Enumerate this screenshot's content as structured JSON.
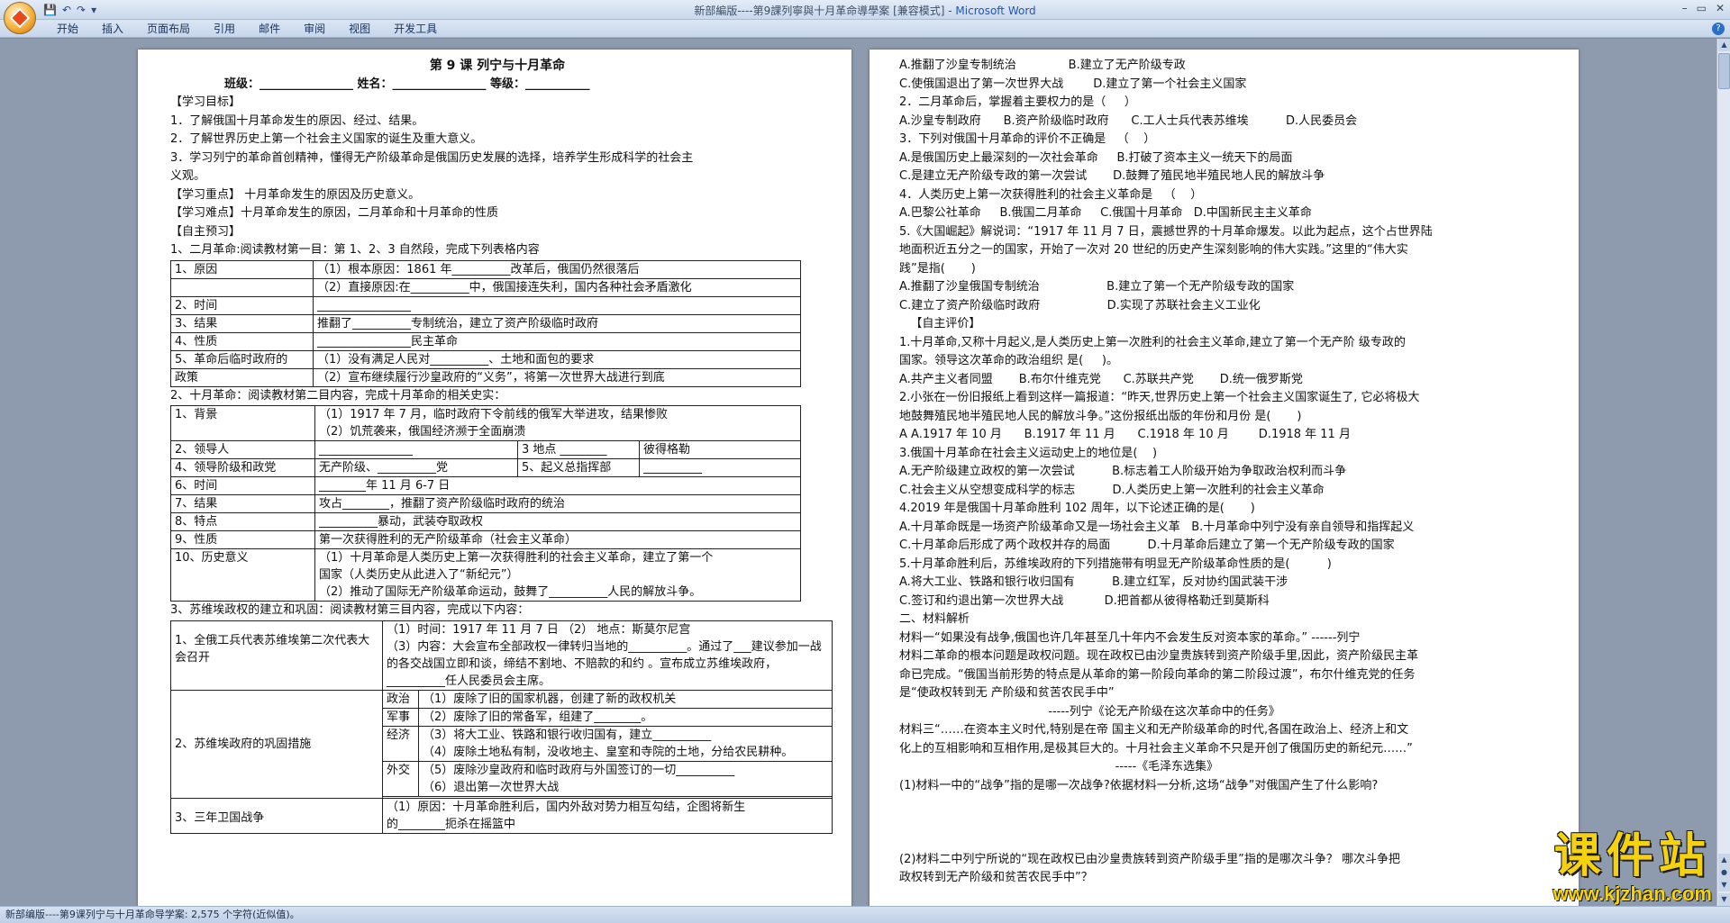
{
  "window": {
    "title_doc": "新部編版----第9課列寧與十月革命導學案 [兼容模式] - ",
    "title_app": "Microsoft Word",
    "qat": [
      "💾",
      "↶",
      "↷",
      "▾"
    ],
    "controls": [
      "–",
      "▭",
      "✕"
    ]
  },
  "ribbon": {
    "tabs": [
      "开始",
      "插入",
      "页面布局",
      "引用",
      "邮件",
      "审阅",
      "视图",
      "开发工具"
    ]
  },
  "page1": {
    "title": "第 9 课 列宁与十月革命",
    "header_line": "班级：________________  姓名：________________  等级：___________",
    "goals_head": "【学习目标】",
    "goals": [
      "1．了解俄国十月革命发生的原因、经过、结果。",
      "2．了解世界历史上第一个社会主义国家的诞生及重大意义。",
      "3．学习列宁的革命首创精神，懂得无产阶级革命是俄国历史发展的选择，培养学生形成科学的社会主",
      "义观。"
    ],
    "key": "【学习重点】  十月革命发生的原因及历史意义。",
    "difficult": "【学习难点】十月革命发生的原因，二月革命和十月革命的性质",
    "preview_head": "【自主预习】",
    "s1_title": "1、二月革命:阅读教材第一目：第 1、2、3 自然段，完成下列表格内容",
    "t1": [
      [
        "1、原因",
        "（1）根本原因：1861 年__________改革后，俄国仍然很落后"
      ],
      [
        "",
        "（2）直接原因:在__________中，俄国接连失利，国内各种社会矛盾激化"
      ],
      [
        "2、时间",
        "________________"
      ],
      [
        "3、结果",
        "推翻了__________专制统治，建立了资产阶级临时政府"
      ],
      [
        "4、性质",
        "________________民主革命"
      ],
      [
        "5、革命后临时政府的",
        "（1）没有满足人民对__________、土地和面包的要求"
      ],
      [
        "政策",
        "（2）宣布继续履行沙皇政府的“义务”，将第一次世界大战进行到底"
      ]
    ],
    "s2_title": "2、十月革命：阅读教材第二目内容，完成十月革命的相关史实：",
    "t2": {
      "bg_label": "1、背景",
      "bg_1": "（1）1917 年 7 月，临时政府下令前线的俄军大举进攻，结果惨败",
      "bg_2": "（2）饥荒袭来，俄国经济濒于全面崩溃",
      "leader_label": "2、领导人",
      "leader_val": "________________",
      "place_label": "3 地点",
      "place_val": "________",
      "place_name": "彼得格勒",
      "class_label": "4、领导阶级和政党",
      "class_val": "无产阶级、__________党",
      "hq_label": "5、起义总指挥部",
      "hq_val": "__________",
      "time_label": "6、时间",
      "time_val": "________年 11 月 6-7 日",
      "result_label": "7、结果",
      "result_val": "攻占________，推翻了资产阶级临时政府的统治",
      "feature_label": "8、特点",
      "feature_val": "__________暴动，武装夺取政权",
      "nature_label": "9、性质",
      "nature_val": "第一次获得胜利的无产阶级革命（社会主义革命）",
      "sig_label": "10、历史意义",
      "sig_1": "（1）十月革命是人类历史上第一次获得胜利的社会主义革命，建立了第一个",
      "sig_2": "国家（人类历史从此进入了“新纪元”）",
      "sig_3": "（2）推动了国际无产阶级革命运动，鼓舞了__________人民的解放斗争。"
    },
    "s3_title": "3、苏维埃政权的建立和巩固：阅读教材第三目内容，完成以下内容：",
    "t3": {
      "congress_label": "1、全俄工兵代表苏维埃第二次代表大会召开",
      "c_time": "（1）时间：1917 年 11 月 7 日  （2） 地点：斯莫尔尼宫",
      "c_content": "（3）内容：大会宣布全部政权一律转归当地的__________。通过了___建议参加一战的各交战国立即和谈，缔结不割地、不赔款的和约 。宣布成立苏维埃政府，__________任人民委员会主席。",
      "measures_label": "2、苏维埃政府的巩固措施",
      "m_politics": "政治",
      "m_politics_val": "（1）废除了旧的国家机器，创建了新的政权机关",
      "m_army": "军事",
      "m_army_val": "（2）废除了旧的常备军，组建了________。",
      "m_economy": "经济",
      "m_economy_val1": "（3）将大工业、铁路和银行收归国有，建立__________",
      "m_economy_val2": "（4）废除土地私有制，没收地主、皇室和寺院的土地，分给农民耕种。",
      "m_diplomacy": "外交",
      "m_diplomacy_val1": "（5）废除沙皇政府和临时政府与外国签订的一切__________",
      "m_diplomacy_val2": "（6）退出第一次世界大战",
      "defense_label": "3、三年卫国战争",
      "defense_val1": "（1）原因：十月革命胜利后，国内外敌对势力相互勾结，企图将新生",
      "defense_val2": "的________扼杀在摇篮中"
    }
  },
  "page2": {
    "lines": [
      "A.推翻了沙皇专制统治              B.建立了无产阶级专政",
      "C.使俄国退出了第一次世界大战        D.建立了第一个社会主义国家",
      "2．二月革命后，掌握着主要权力的是（     ）",
      "A.沙皇专制政府      B.资产阶级临时政府      C.工人士兵代表苏维埃          D.人民委员会",
      "3．下列对俄国十月革命的评价不正确是   （    ）",
      "A.是俄国历史上最深刻的一次社会革命     B.打破了资本主义一统天下的局面",
      "C.是建立无产阶级专政的第一次尝试       D.鼓舞了殖民地半殖民地人民的解放斗争",
      "4．人类历史上第一次获得胜利的社会主义革命是   （    ）",
      "A.巴黎公社革命     B.俄国二月革命     C.俄国十月革命   D.中国新民主主义革命",
      "5.《大国崛起》解说词：“1917 年 11 月 7 日，震撼世界的十月革命爆发。以此为起点，这个占世界陆",
      "地面积近五分之一的国家，开始了一次对 20 世纪的历史产生深刻影响的伟大实践。”这里的“伟大实",
      "践”是指(       )",
      "A.推翻了沙皇俄国专制统治                  B.建立了第一个无产阶级专政的国家",
      "C.建立了资产阶级临时政府                  D.实现了苏联社会主义工业化",
      "   【自主评价】",
      "1.十月革命,又称十月起义,是人类历史上第一次胜利的社会主义革命,建立了第一个无产阶 级专政的",
      "国家。领导这次革命的政治组织 是(     )。",
      "A.共产主义者同盟       B.布尔什维克党      C.苏联共产党       D.统一俄罗斯党",
      "2.小张在一份旧报纸上看到这样一篇报道：“昨天,世界历史上第一个社会主义国家诞生了, 它必将极大",
      "地鼓舞殖民地半殖民地人民的解放斗争。”这份报纸出版的年份和月份 是(       )",
      "A A.1917 年 10 月      B.1917 年 11 月      C.1918 年 10 月        D.1918 年 11 月",
      "3.俄国十月革命在社会主义运动史上的地位是(    )",
      "A.无产阶级建立政权的第一次尝试          B.标志着工人阶级开始为争取政治权利而斗争",
      "C.社会主义从空想变成科学的标志          D.人类历史上第一次胜利的社会主义革命",
      "4.2019 年是俄国十月革命胜利 102 周年，以下论述正确的是(       )",
      "A.十月革命既是一场资产阶级革命又是一场社会主义革   B.十月革命中列宁没有亲自领导和指挥起义",
      "C.十月革命后形成了两个政权并存的局面          D.十月革命后建立了第一个无产阶级专政的国家",
      "5.十月革命胜利后，苏维埃政府的下列措施带有明显无产阶级革命性质的是(          )",
      "A.将大工业、铁路和银行收归国有          B.建立红军，反对协约国武装干涉",
      "C.签订和约退出第一次世界大战           D.把首都从彼得格勒迁到莫斯科",
      "二、材料解析",
      "材料一“如果没有战争,俄国也许几年甚至几十年内不会发生反对资本家的革命。” ------列宁",
      "材料二革命的根本问题是政权问题。现在政权已由沙皇贵族转到资产阶级手里,因此，资产阶级民主革",
      "命已完成。“俄国当前形势的特点是从革命的第一阶段向革命的第二阶段过渡”，布尔什维克党的任务",
      "是“使政权转到无 产阶级和贫苦农民手中”",
      "                                        -----列宁《论无产阶级在这次革命中的任务》",
      "材料三“……在资本主义时代,特别是在帝 国主义和无产阶级革命的时代,各国在政治上、经济上和文",
      "化上的互相影响和互相作用,是极其巨大的。十月社会主义革命不只是开创了俄国历史的新纪元……”",
      "                                                          -----《毛泽东选集》",
      "(1)材料一中的“战争”指的是哪一次战争?依据材料一分析,这场“战争”对俄国产生了什么影响?",
      "",
      "",
      "",
      "(2)材料二中列宁所说的“现在政权已由沙皇贵族转到资产阶级手里”指的是哪次斗争？ 哪次斗争把",
      "政权转到无产阶级和贫苦农民手中”？"
    ]
  },
  "statusbar": {
    "text": "新部编版----第9课列宁与十月革命导学案: 2,575 个字符(近似值)。"
  },
  "watermark": {
    "big": "课件站",
    "url": "www.kjzhan.com"
  }
}
